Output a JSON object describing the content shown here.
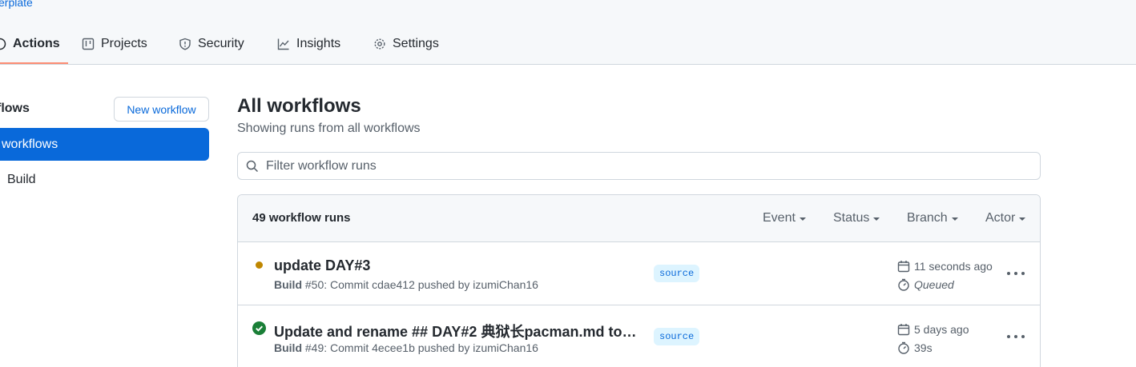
{
  "repo": {
    "crumb": "erplate"
  },
  "nav": [
    {
      "key": "actions",
      "label": "Actions",
      "icon": "play-icon",
      "active": true
    },
    {
      "key": "projects",
      "label": "Projects",
      "icon": "table-icon"
    },
    {
      "key": "security",
      "label": "Security",
      "icon": "shield-icon"
    },
    {
      "key": "insights",
      "label": "Insights",
      "icon": "graph-icon"
    },
    {
      "key": "settings",
      "label": "Settings",
      "icon": "gear-icon"
    }
  ],
  "sidebar": {
    "title": "flows",
    "new_workflow": "New workflow",
    "active_item": "workflows",
    "items": [
      "Build"
    ]
  },
  "main": {
    "title": "All workflows",
    "subtitle": "Showing runs from all workflows",
    "filter_placeholder": "Filter workflow runs"
  },
  "runs_box": {
    "count": "49 workflow runs",
    "filters": [
      "Event",
      "Status",
      "Branch",
      "Actor"
    ]
  },
  "runs": [
    {
      "title": "update DAY#3",
      "workflow": "Build",
      "meta": "#50: Commit cdae412 pushed by izumiChan16",
      "branch": "source",
      "time": "11 seconds ago",
      "duration": "Queued",
      "status": "queued",
      "status_color": "#bf8700"
    },
    {
      "title": "Update and rename ## DAY#2 典狱长pacman.md to…",
      "workflow": "Build",
      "meta": "#49: Commit 4ecee1b pushed by izumiChan16",
      "branch": "source",
      "time": "5 days ago",
      "duration": "39s",
      "status": "success",
      "status_color": "#1a7f37"
    }
  ],
  "colors": {
    "accent": "#0969da",
    "nav_underline": "#fd8c73"
  }
}
